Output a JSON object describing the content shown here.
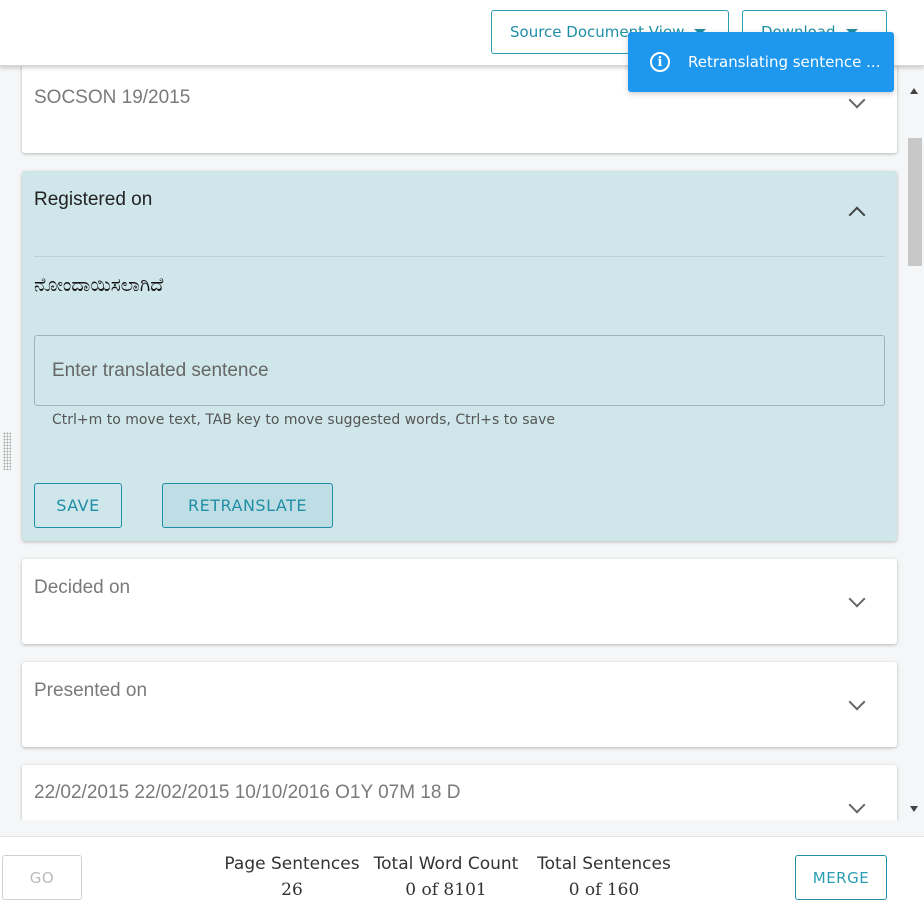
{
  "topbar": {
    "source_view_label": "Source Document View",
    "download_label": "Download"
  },
  "toast": {
    "message": "Retranslating sentence ..."
  },
  "sentences": [
    {
      "text": "SOCSON 19/2015"
    },
    {
      "text": "Registered on",
      "translation": "ನೋಂದಾಯಿಸಲಾಗಿದೆ",
      "input_placeholder": "Enter translated sentence",
      "helper": "Ctrl+m to move text, TAB key to move suggested words, Ctrl+s to save",
      "save_label": "SAVE",
      "retranslate_label": "RETRANSLATE"
    },
    {
      "text": "Decided on"
    },
    {
      "text": "Presented on"
    },
    {
      "text": "22/02/2015 22/02/2015 10/10/2016 O1Y 07M 18 D"
    }
  ],
  "footer": {
    "go_label": "GO",
    "page_sentences_label": "Page Sentences",
    "page_sentences_value": "26",
    "word_count_label": "Total Word Count",
    "word_count_value": "0 of 8101",
    "total_sentences_label": "Total Sentences",
    "total_sentences_value": "0 of 160",
    "merge_label": "MERGE"
  }
}
